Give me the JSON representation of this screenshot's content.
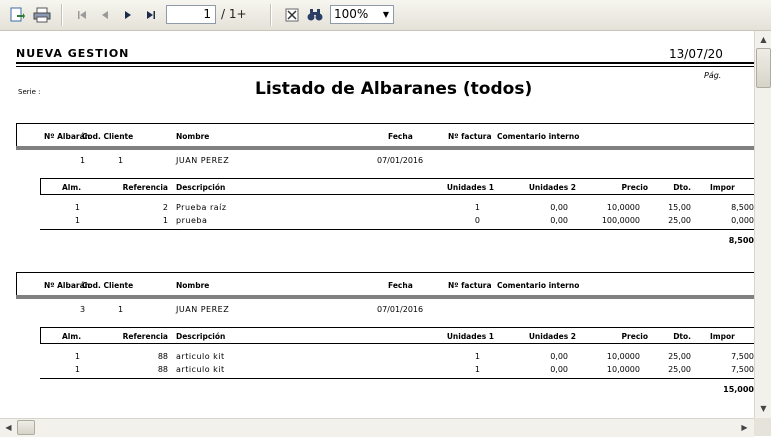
{
  "toolbar": {
    "page_current": "1",
    "page_total": "/ 1+",
    "zoom": "100%"
  },
  "report": {
    "company": "NUEVA GESTION",
    "date": "13/07/20",
    "page_label": "Pág.",
    "serie_label": "Serie :",
    "title": "Listado de  Albaranes (todos)",
    "header_cols": [
      "Nº Albarán",
      "Cod. Cliente",
      "Nombre",
      "Fecha",
      "Nº factura",
      "Comentario interno"
    ],
    "line_cols": [
      "Alm.",
      "Referencia",
      "Descripción",
      "Unidades 1",
      "Unidades 2",
      "Precio",
      "Dto.",
      "Impor"
    ],
    "albaranes": [
      {
        "numero": "1",
        "cliente": "1",
        "nombre": "JUAN PEREZ",
        "fecha": "07/01/2016",
        "lines": [
          {
            "alm": "1",
            "ref": "2",
            "desc": "Prueba raíz",
            "u1": "1",
            "u2": "0,00",
            "precio": "10,0000",
            "dto": "15,00",
            "imp": "8,500"
          },
          {
            "alm": "1",
            "ref": "1",
            "desc": "prueba",
            "u1": "0",
            "u2": "0,00",
            "precio": "100,0000",
            "dto": "25,00",
            "imp": "0,000"
          }
        ],
        "total": "8,500"
      },
      {
        "numero": "3",
        "cliente": "1",
        "nombre": "JUAN PEREZ",
        "fecha": "07/01/2016",
        "lines": [
          {
            "alm": "1",
            "ref": "88",
            "desc": "articulo kit",
            "u1": "1",
            "u2": "0,00",
            "precio": "10,0000",
            "dto": "25,00",
            "imp": "7,500"
          },
          {
            "alm": "1",
            "ref": "88",
            "desc": "articulo kit",
            "u1": "1",
            "u2": "0,00",
            "precio": "10,0000",
            "dto": "25,00",
            "imp": "7,500"
          }
        ],
        "total": "15,000"
      }
    ]
  }
}
